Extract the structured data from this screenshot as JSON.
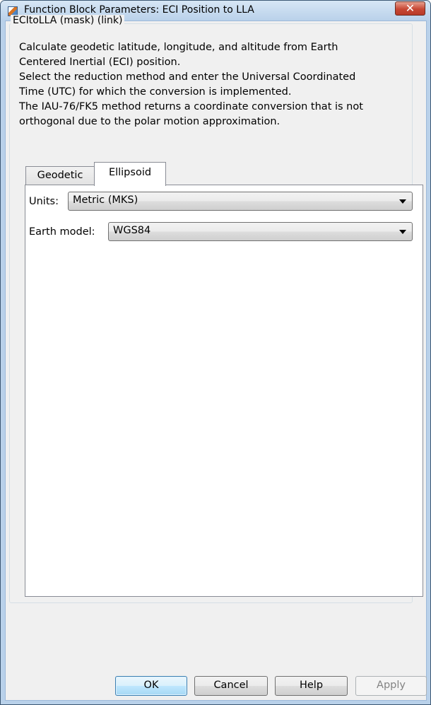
{
  "window": {
    "title": "Function Block Parameters: ECI Position to LLA",
    "app_icon": "simulink-block-icon",
    "close_icon": "close-icon",
    "close_glyph": "✕"
  },
  "mask": {
    "group_label": "ECItoLLA (mask) (link)",
    "description_lines": [
      "Calculate geodetic latitude, longitude, and altitude from Earth",
      "Centered Inertial (ECI) position.",
      "Select the reduction method and enter the Universal Coordinated",
      "Time (UTC) for which the conversion is implemented.",
      "The IAU-76/FK5 method returns a coordinate conversion that is not",
      "orthogonal due to the polar motion approximation."
    ]
  },
  "tabs": [
    {
      "label": "Geodetic",
      "selected": false
    },
    {
      "label": "Ellipsoid",
      "selected": true
    }
  ],
  "ellipsoid": {
    "units": {
      "label": "Units:",
      "value": "Metric (MKS)"
    },
    "earth_model": {
      "label": "Earth model:",
      "value": "WGS84"
    },
    "dropdown_icon": "chevron-down-icon"
  },
  "buttons": {
    "ok": "OK",
    "cancel": "Cancel",
    "help": "Help",
    "apply": "Apply"
  }
}
